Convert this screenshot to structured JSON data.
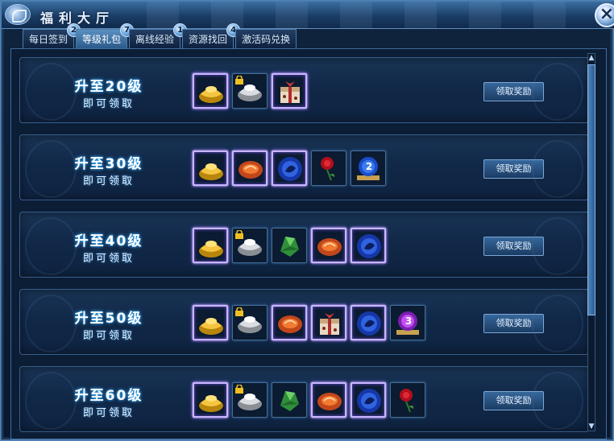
{
  "window": {
    "title": "福利大厅"
  },
  "tabs": [
    {
      "label": "每日签到",
      "badge": "2",
      "active": false
    },
    {
      "label": "等级礼包",
      "badge": "7",
      "active": true
    },
    {
      "label": "离线经验",
      "badge": "1",
      "active": false
    },
    {
      "label": "资源找回",
      "badge": "4",
      "active": false
    },
    {
      "label": "激活码兑换",
      "badge": "",
      "active": false
    }
  ],
  "rows": [
    {
      "level_label": "升至20级",
      "sub_label": "即可领取",
      "button": "领取奖励",
      "items": [
        {
          "icon": "gold-ingot-icon",
          "glow": true,
          "locked": false
        },
        {
          "icon": "silver-ingot-icon",
          "glow": false,
          "locked": true
        },
        {
          "icon": "gift-box-icon",
          "glow": true,
          "locked": false
        }
      ]
    },
    {
      "level_label": "升至30级",
      "sub_label": "即可领取",
      "button": "领取奖励",
      "items": [
        {
          "icon": "gold-ingot-icon",
          "glow": true,
          "locked": false
        },
        {
          "icon": "red-orb-icon",
          "glow": true,
          "locked": false
        },
        {
          "icon": "blue-orb-icon",
          "glow": true,
          "locked": false
        },
        {
          "icon": "rose-icon",
          "glow": false,
          "locked": false
        },
        {
          "icon": "blue-badge-icon",
          "glow": false,
          "locked": false,
          "number": "2"
        }
      ]
    },
    {
      "level_label": "升至40级",
      "sub_label": "即可领取",
      "button": "领取奖励",
      "items": [
        {
          "icon": "gold-ingot-icon",
          "glow": true,
          "locked": false
        },
        {
          "icon": "silver-ingot-icon",
          "glow": false,
          "locked": true
        },
        {
          "icon": "green-gem-icon",
          "glow": false,
          "locked": false
        },
        {
          "icon": "red-orb-icon",
          "glow": true,
          "locked": false
        },
        {
          "icon": "blue-orb-icon",
          "glow": true,
          "locked": false
        }
      ]
    },
    {
      "level_label": "升至50级",
      "sub_label": "即可领取",
      "button": "领取奖励",
      "items": [
        {
          "icon": "gold-ingot-icon",
          "glow": true,
          "locked": false
        },
        {
          "icon": "silver-ingot-icon",
          "glow": false,
          "locked": true
        },
        {
          "icon": "red-orb-icon",
          "glow": true,
          "locked": false
        },
        {
          "icon": "gift-box-icon",
          "glow": true,
          "locked": false
        },
        {
          "icon": "blue-orb-icon",
          "glow": true,
          "locked": false
        },
        {
          "icon": "purple-badge-icon",
          "glow": false,
          "locked": false,
          "number": "3"
        }
      ]
    },
    {
      "level_label": "升至60级",
      "sub_label": "即可领取",
      "button": "领取奖励",
      "items": [
        {
          "icon": "gold-ingot-icon",
          "glow": true,
          "locked": false
        },
        {
          "icon": "silver-ingot-icon",
          "glow": false,
          "locked": true
        },
        {
          "icon": "green-gem-icon",
          "glow": false,
          "locked": false
        },
        {
          "icon": "red-orb-icon",
          "glow": true,
          "locked": false
        },
        {
          "icon": "blue-orb-icon",
          "glow": true,
          "locked": false
        },
        {
          "icon": "rose-icon",
          "glow": false,
          "locked": false
        }
      ]
    }
  ],
  "colors": {
    "frame": "#4d7fb0",
    "row_bg": "#112848",
    "level_glow": "#3fb6ff",
    "item_glow": "#8f6cff"
  }
}
